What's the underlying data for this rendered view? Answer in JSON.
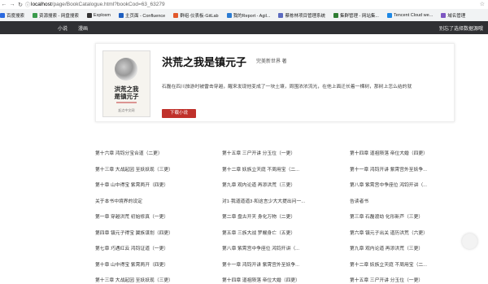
{
  "browser": {
    "url_host": "localhost",
    "url_path": "/page/BookCatalogue.html?bookCod=63_63279",
    "bookmarks": [
      {
        "label": "百度搜索",
        "color": "#2a6ae0"
      },
      {
        "label": "资源搜索 - 网盘搜索",
        "color": "#3a9b4c"
      },
      {
        "label": "Explosm",
        "color": "#333333"
      },
      {
        "label": "主页面 - Confluence",
        "color": "#1f5fc0"
      },
      {
        "label": "群组·仪表板·GitLab",
        "color": "#e2592b"
      },
      {
        "label": "我的Report - Agil...",
        "color": "#2b7cd3"
      },
      {
        "label": "蔡栋林项目管理系统",
        "color": "#5c6bc0"
      },
      {
        "label": "集群管理 - 网站集...",
        "color": "#2e7d32"
      },
      {
        "label": "Tencent Cloud we...",
        "color": "#1e88e5"
      },
      {
        "label": "域名管理",
        "color": "#7e57c2"
      }
    ]
  },
  "topnav": {
    "links": [
      "小说",
      "漫画"
    ],
    "right_text": "别忘了选择数据源哦"
  },
  "book": {
    "title": "洪荒之我是镇元子",
    "author": "完美新世界 著",
    "description": "石磊在四川旅游时被雷击穿越，醒来发现他变成了一块土壤，周围浓浓流光，在他上面迁长着一棵树，那树上怎么结的就",
    "download_label": "下载小说",
    "cover_title_line1": "洪荒之我",
    "cover_title_line2": "是镇元子",
    "cover_footer": "起点中文网"
  },
  "chapters": [
    [
      "第十六章 鸿钧分宝合道（二更）",
      "第十五章 三尸开讲 分玉位（一更）",
      "第十四章 道祖陨落 帝位大婚（四更）"
    ],
    [
      "第十三章 大战起因 至妖妖现（三更）",
      "第十二章 妖族立天庭 不周用宝（二...",
      "第十一章 鸿钧开讲 紫霄宫外至妖争..."
    ],
    [
      "第十章 山中得宝 紫霄两开（四更）",
      "第九章 观内论道 再添洪荒（三更）",
      "第八章 紫霄宫中争座位 鸿钧开讲（..."
    ],
    [
      "关于本书中境界的设定",
      "对1·我道道道3·和这言少大大提出问一...",
      "告读者书"
    ],
    [
      "第一章 穿越洪荒 初始修真（一更）",
      "第二章 盘古开天 身化万物（二更）",
      "第三章 石磊渡劫 化形新芦（三更）"
    ],
    [
      "第四章 镇元子得宝 翼族谋划（四更）",
      "第五章 三族大战 罗睺身亡（五更）",
      "第六章 镇元子出关 道历洪荒（六更）"
    ],
    [
      "第七章 巧遇红云 鸿钧证道（一更）",
      "第八章 紫霄宫中争座位 鸿钧开讲（...",
      "第九章 观内论道 再添洪荒（三更）"
    ],
    [
      "第十章 山中得宝 紫霄两开（四更）",
      "第十一章 鸿钧开讲 紫霄宫外至妖争...",
      "第十二章 妖族立天庭 不周用宝（二..."
    ],
    [
      "第十三章 大战起因 至妖妖现（三更）",
      "第十四章 道祖陨落 帝位大婚（四更）",
      "第十五章 三尸开讲 分玉位（一更）"
    ]
  ]
}
